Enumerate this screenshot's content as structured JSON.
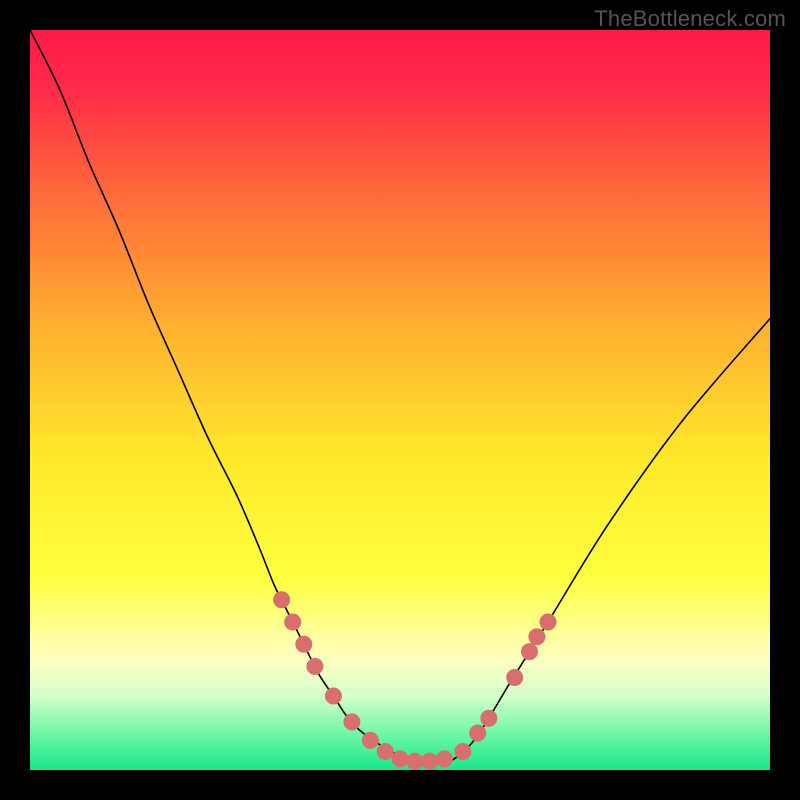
{
  "watermark": "TheBottleneck.com",
  "chart_data": {
    "type": "line",
    "title": "",
    "xlabel": "",
    "ylabel": "",
    "xlim": [
      0,
      100
    ],
    "ylim": [
      0,
      100
    ],
    "grid": false,
    "legend": false,
    "background": {
      "type": "vertical-gradient",
      "stops": [
        {
          "pos": 0.0,
          "color": "#ff1a4b"
        },
        {
          "pos": 0.08,
          "color": "#ff2a48"
        },
        {
          "pos": 0.22,
          "color": "#ff6a3a"
        },
        {
          "pos": 0.4,
          "color": "#ffb030"
        },
        {
          "pos": 0.58,
          "color": "#ffe92a"
        },
        {
          "pos": 0.74,
          "color": "#ffff40"
        },
        {
          "pos": 0.8,
          "color": "#ffff88"
        },
        {
          "pos": 0.85,
          "color": "#fdffc0"
        },
        {
          "pos": 0.9,
          "color": "#d4ffca"
        },
        {
          "pos": 0.95,
          "color": "#70f7a8"
        },
        {
          "pos": 1.0,
          "color": "#18e78a"
        }
      ]
    },
    "series": [
      {
        "name": "curve",
        "stroke": "#000000",
        "stroke_width": 1.6,
        "x": [
          0,
          4,
          8,
          12,
          16,
          20,
          24,
          28,
          31,
          33,
          35,
          37,
          39,
          41,
          43,
          45,
          48,
          52,
          56,
          58,
          60,
          62,
          65,
          70,
          78,
          88,
          100
        ],
        "y": [
          100,
          92,
          82,
          73,
          63,
          54,
          45,
          37,
          30,
          25,
          21,
          17,
          13,
          10,
          7,
          5,
          3,
          1,
          1,
          2,
          4,
          7,
          12,
          20,
          33,
          47,
          61
        ]
      }
    ],
    "markers": {
      "name": "beads",
      "fill": "#d96e6e",
      "stroke": "#d96e6e",
      "radius_px": 8,
      "points": [
        {
          "x": 34.0,
          "y": 23.0
        },
        {
          "x": 35.5,
          "y": 20.0
        },
        {
          "x": 37.0,
          "y": 17.0
        },
        {
          "x": 38.5,
          "y": 14.0
        },
        {
          "x": 41.0,
          "y": 10.0
        },
        {
          "x": 43.5,
          "y": 6.5
        },
        {
          "x": 46.0,
          "y": 4.0
        },
        {
          "x": 48.0,
          "y": 2.5
        },
        {
          "x": 50.0,
          "y": 1.5
        },
        {
          "x": 52.0,
          "y": 1.2
        },
        {
          "x": 54.0,
          "y": 1.2
        },
        {
          "x": 56.0,
          "y": 1.5
        },
        {
          "x": 58.5,
          "y": 2.5
        },
        {
          "x": 60.5,
          "y": 5.0
        },
        {
          "x": 62.0,
          "y": 7.0
        },
        {
          "x": 65.5,
          "y": 12.5
        },
        {
          "x": 67.5,
          "y": 16.0
        },
        {
          "x": 68.5,
          "y": 18.0
        },
        {
          "x": 70.0,
          "y": 20.0
        }
      ]
    }
  }
}
